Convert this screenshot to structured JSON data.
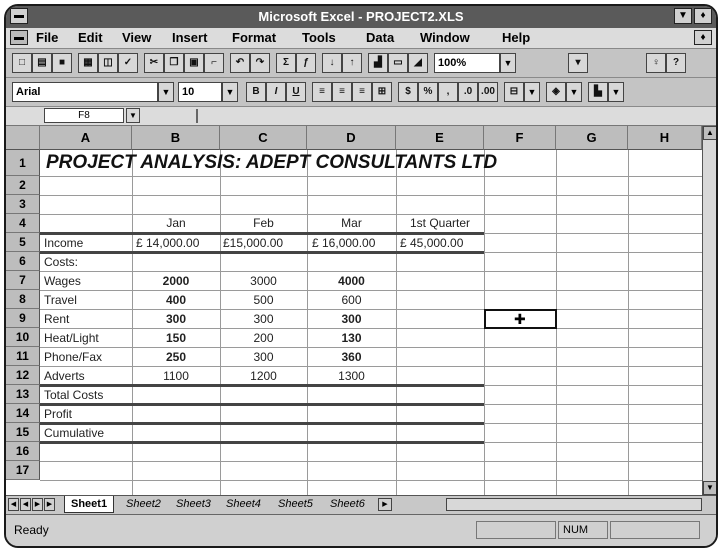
{
  "window": {
    "title": "Microsoft Excel - PROJECT2.XLS"
  },
  "menu": [
    "File",
    "Edit",
    "View",
    "Insert",
    "Format",
    "Tools",
    "Data",
    "Window",
    "Help"
  ],
  "toolbar": {
    "zoom": "100%"
  },
  "format_bar": {
    "font": "Arial",
    "size": "10"
  },
  "formula_bar": {
    "cell_ref": "F8",
    "content": ""
  },
  "columns": [
    "A",
    "B",
    "C",
    "D",
    "E",
    "F",
    "G",
    "H"
  ],
  "rows": [
    "1",
    "2",
    "3",
    "4",
    "5",
    "6",
    "7",
    "8",
    "9",
    "10",
    "11",
    "12",
    "13",
    "14",
    "15",
    "16",
    "17"
  ],
  "sheet": {
    "title": "PROJECT ANALYSIS: ADEPT CONSULTANTS LTD",
    "headers": [
      "Jan",
      "Feb",
      "Mar",
      "1st Quarter"
    ],
    "income": {
      "label": "Income",
      "values": [
        "£ 14,000.00",
        "£15,000.00",
        "£ 16,000.00",
        "£ 45,000.00"
      ]
    },
    "costs_label": "Costs:",
    "cost_rows": [
      {
        "label": "Wages",
        "values": [
          "2000",
          "3000",
          "4000"
        ]
      },
      {
        "label": "Travel",
        "values": [
          "400",
          "500",
          "600"
        ]
      },
      {
        "label": "Rent",
        "values": [
          "300",
          "300",
          "300"
        ]
      },
      {
        "label": "Heat/Light",
        "values": [
          "150",
          "200",
          "130"
        ]
      },
      {
        "label": "Phone/Fax",
        "values": [
          "250",
          "300",
          "360"
        ]
      },
      {
        "label": "Adverts",
        "values": [
          "1100",
          "1200",
          "1300"
        ]
      }
    ],
    "total_costs": "Total Costs",
    "profit": "Profit",
    "cumulative": "Cumulative"
  },
  "tabs": [
    "Sheet1",
    "Sheet2",
    "Sheet3",
    "Sheet4",
    "Sheet5",
    "Sheet6"
  ],
  "status": {
    "text": "Ready",
    "num": "NUM"
  }
}
